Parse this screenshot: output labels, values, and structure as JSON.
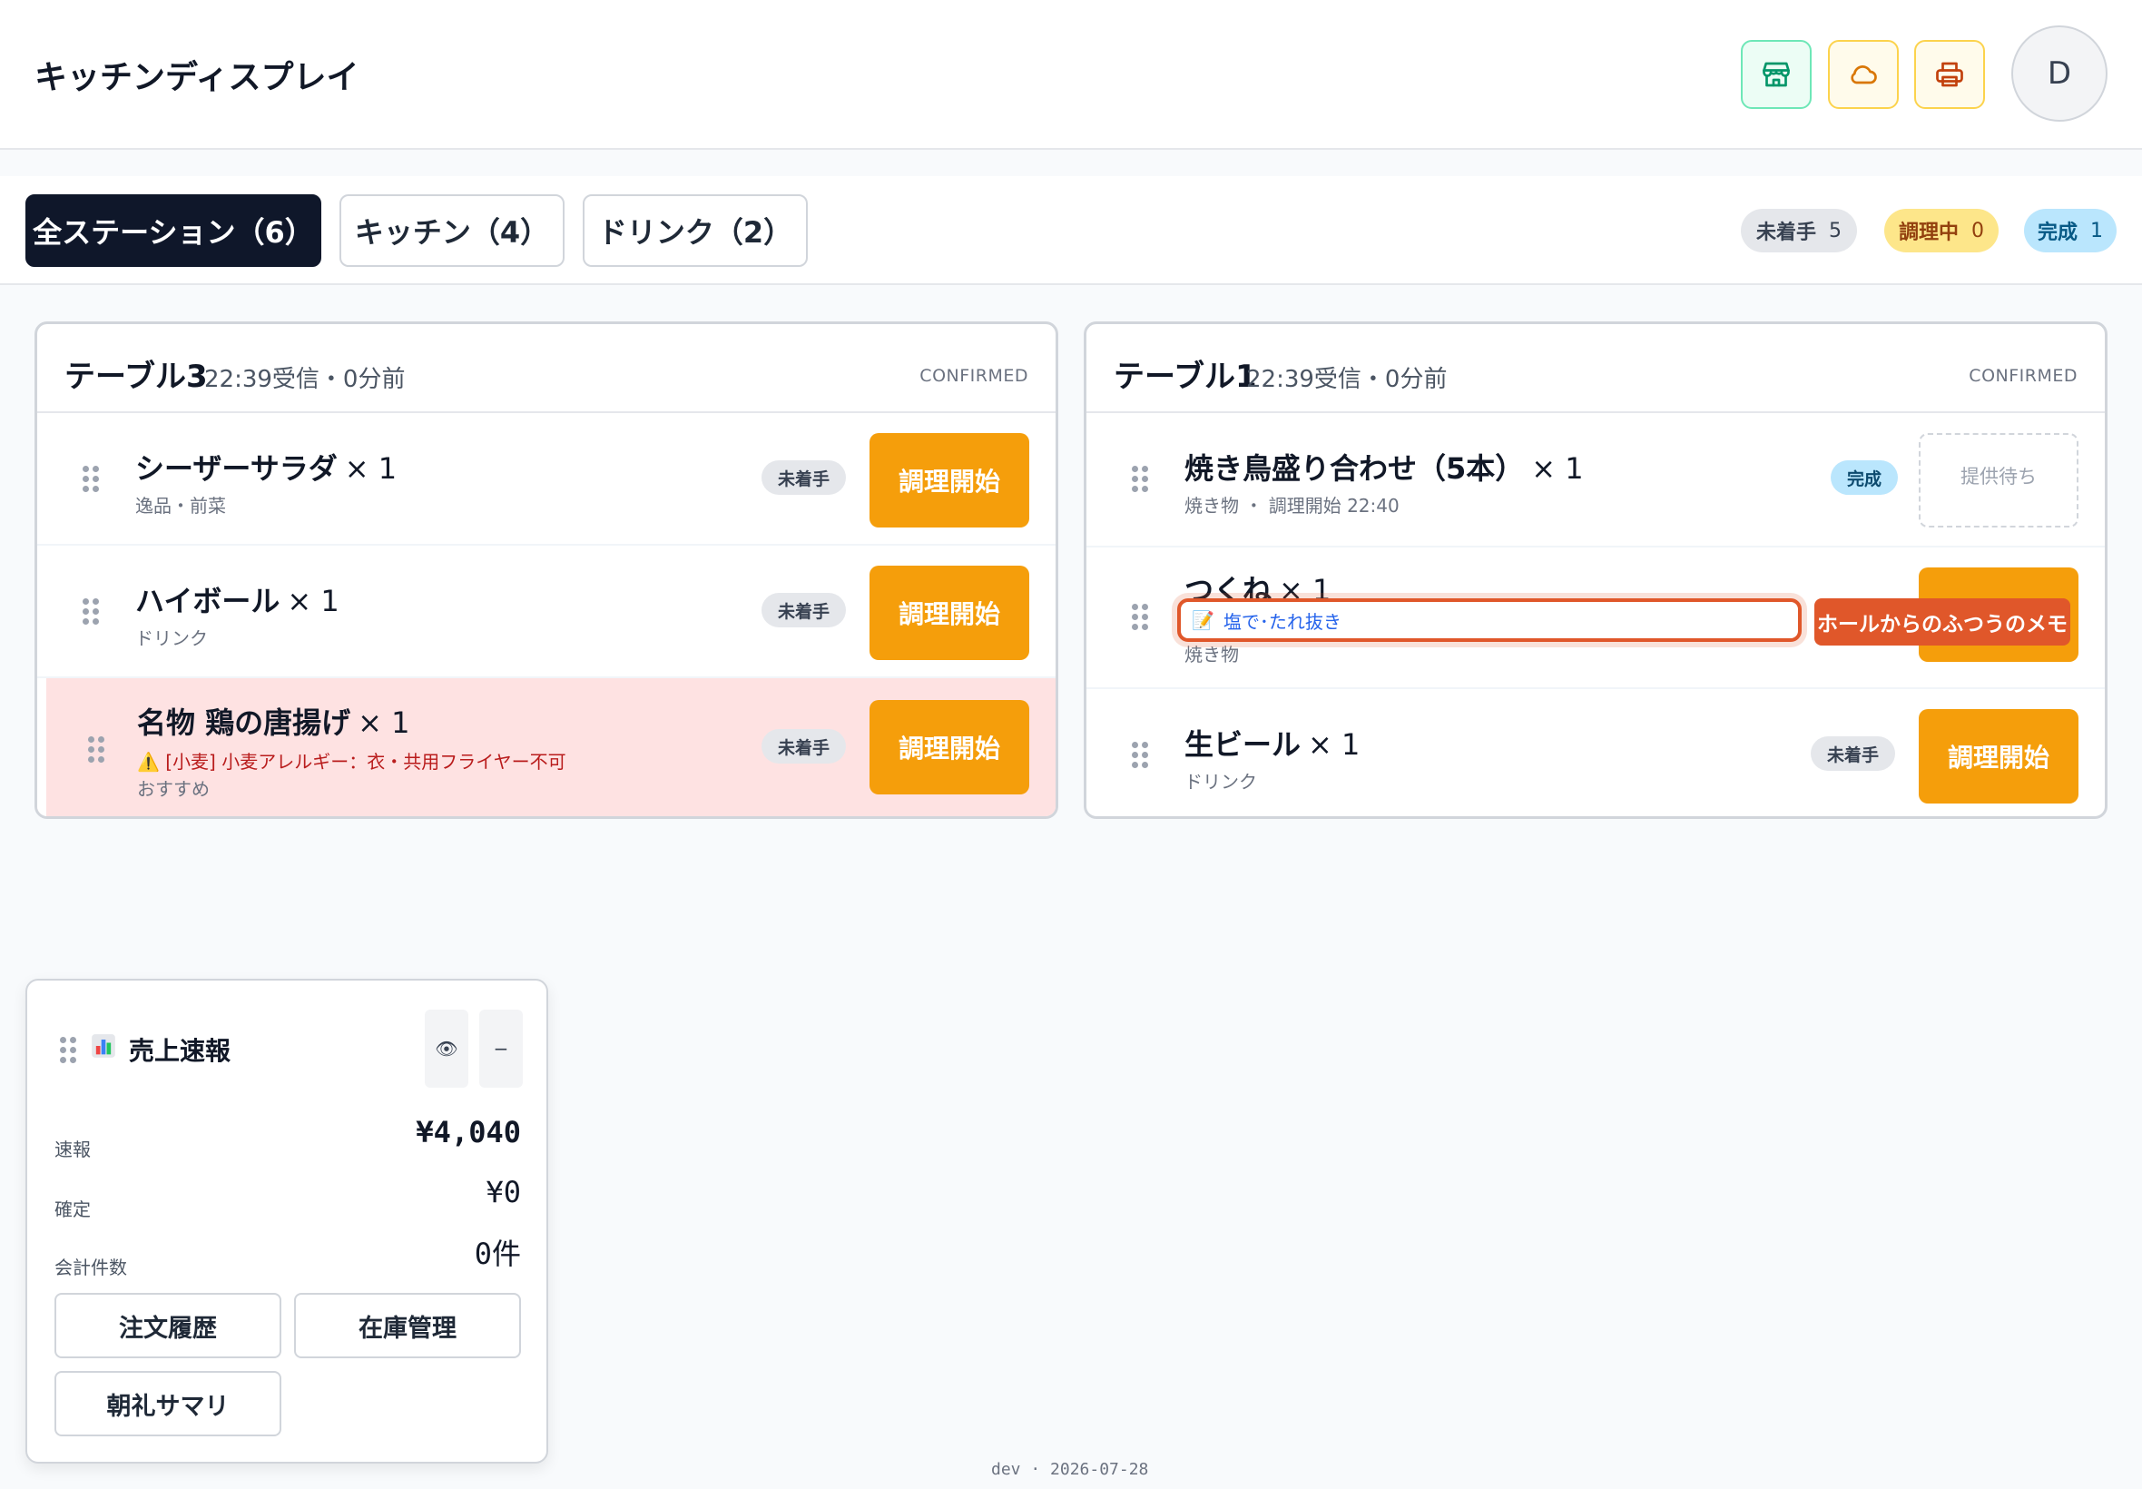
{
  "header": {
    "title": "キッチンディスプレイ",
    "avatar_initial": "D",
    "icons": [
      "store-icon",
      "cloud-icon",
      "printer-icon"
    ],
    "colors": {
      "store": "#059669",
      "cloud": "#d97706",
      "printer": "#c2410c"
    }
  },
  "stations": {
    "tabs": [
      {
        "label": "全ステーション（6）",
        "active": true
      },
      {
        "label": "キッチン（4）",
        "active": false
      },
      {
        "label": "ドリンク（2）",
        "active": false
      }
    ],
    "counts": {
      "pending_label": "未着手",
      "pending": "5",
      "cooking_label": "調理中",
      "cooking": "0",
      "done_label": "完成",
      "done": "1"
    }
  },
  "tables": [
    {
      "title": "テーブル3",
      "time": "22:39受信・0分前",
      "status": "CONFIRMED",
      "items": [
        {
          "name": "シーザーサラダ",
          "qty": "× 1",
          "sub": "逸品・前菜",
          "badge": "未着手",
          "action": "調理開始"
        },
        {
          "name": "ハイボール",
          "qty": "× 1",
          "sub": "ドリンク",
          "badge": "未着手",
          "action": "調理開始"
        },
        {
          "name": "名物 鶏の唐揚げ",
          "qty": "× 1",
          "allergy": "⚠️ [小麦] 小麦アレルギー：衣・共用フライヤー不可",
          "sub": "おすすめ",
          "badge": "未着手",
          "action": "調理開始"
        }
      ]
    },
    {
      "title": "テーブル1",
      "time": "22:39受信・0分前",
      "status": "CONFIRMED",
      "items": [
        {
          "name": "焼き鳥盛り合わせ（5本）",
          "qty": "× 1",
          "sub": "焼き物 ・ 調理開始 22:40",
          "badge": "完成",
          "action": "提供待ち"
        },
        {
          "name": "つくね",
          "qty": "× 1",
          "memo": "塩で･たれ抜き",
          "memo_tag": "ホールからのふつうのメモ",
          "sub": "焼き物"
        },
        {
          "name": "生ビール",
          "qty": "× 1",
          "sub": "ドリンク",
          "badge": "未着手",
          "action": "調理開始"
        }
      ]
    }
  ],
  "sales": {
    "title": "売上速報",
    "eye": "👁",
    "minimize": "−",
    "rows": [
      {
        "label": "速報",
        "value": "¥4,040"
      },
      {
        "label": "確定",
        "value": "¥0"
      },
      {
        "label": "会計件数",
        "value": "0件"
      }
    ],
    "buttons": [
      "注文履歴",
      "在庫管理",
      "朝礼サマリ"
    ]
  },
  "footer": "dev · 2026-07-28"
}
